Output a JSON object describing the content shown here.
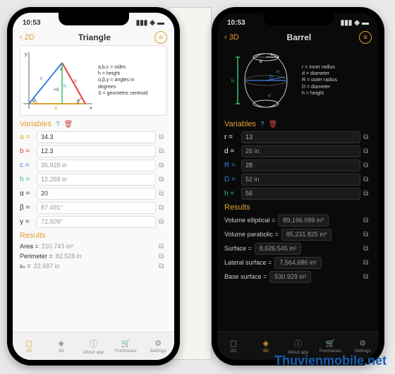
{
  "watermark": "Thuvienmobile.net",
  "phone1": {
    "time": "10:53",
    "back": "‹ 2D",
    "title": "Triangle",
    "legend": {
      "l1": "a,b,c = sides",
      "l2": "h = height",
      "l3": "α,β,γ = angles in",
      "l4": "degrees",
      "l5": "S = geometric centroid"
    },
    "sections": {
      "vars": "Variables",
      "results": "Results"
    },
    "vars": [
      {
        "label": "a =",
        "value": "34.3",
        "color": "c-orange",
        "readonly": false
      },
      {
        "label": "b =",
        "value": "12.3",
        "color": "c-red",
        "readonly": false
      },
      {
        "label": "c =",
        "value": "35.928 in",
        "color": "c-blue",
        "readonly": true
      },
      {
        "label": "h =",
        "value": "12.288 in",
        "color": "c-green",
        "readonly": true
      },
      {
        "label": "α =",
        "value": "20",
        "color": "",
        "readonly": false
      },
      {
        "label": "β =",
        "value": "87.491°",
        "color": "",
        "readonly": true
      },
      {
        "label": "γ =",
        "value": "72.509°",
        "color": "",
        "readonly": true
      }
    ],
    "results": [
      {
        "label": "Area =",
        "value": "210.743 in²"
      },
      {
        "label": "Perimeter =",
        "value": "82.528 in"
      },
      {
        "label": "xₛ =",
        "value": "22.687 in"
      }
    ],
    "tabs": [
      "2D",
      "3D",
      "About app",
      "Purchases",
      "Settings"
    ]
  },
  "phone2": {
    "time": "10:53",
    "back": "‹ 3D",
    "title": "Barrel",
    "legend": {
      "l1": "r = inner radius",
      "l2": "d = diameter",
      "l3": "R = outer radius",
      "l4": "D = diameter",
      "l5": "h = height"
    },
    "sections": {
      "vars": "Variables",
      "results": "Results"
    },
    "vars": [
      {
        "label": "r =",
        "value": "13",
        "color": "c-white",
        "readonly": false
      },
      {
        "label": "d =",
        "value": "26 in",
        "color": "c-white",
        "readonly": true
      },
      {
        "label": "R =",
        "value": "28",
        "color": "c-blue",
        "readonly": false
      },
      {
        "label": "D =",
        "value": "52 in",
        "color": "c-blue",
        "readonly": true
      },
      {
        "label": "h =",
        "value": "56",
        "color": "c-green",
        "readonly": false
      }
    ],
    "results": [
      {
        "label": "Volume elliptical =",
        "value": "89,196.099 in³"
      },
      {
        "label": "Volume parabolic =",
        "value": "85,231.825 in³"
      },
      {
        "label": "Surface =",
        "value": "8,626.545 in²"
      },
      {
        "label": "Lateral surface =",
        "value": "7,564.686 in²"
      },
      {
        "label": "Base surface =",
        "value": "530.929 in²"
      }
    ],
    "tabs": [
      "2D",
      "3D",
      "About app",
      "Purchases",
      "Settings"
    ]
  }
}
